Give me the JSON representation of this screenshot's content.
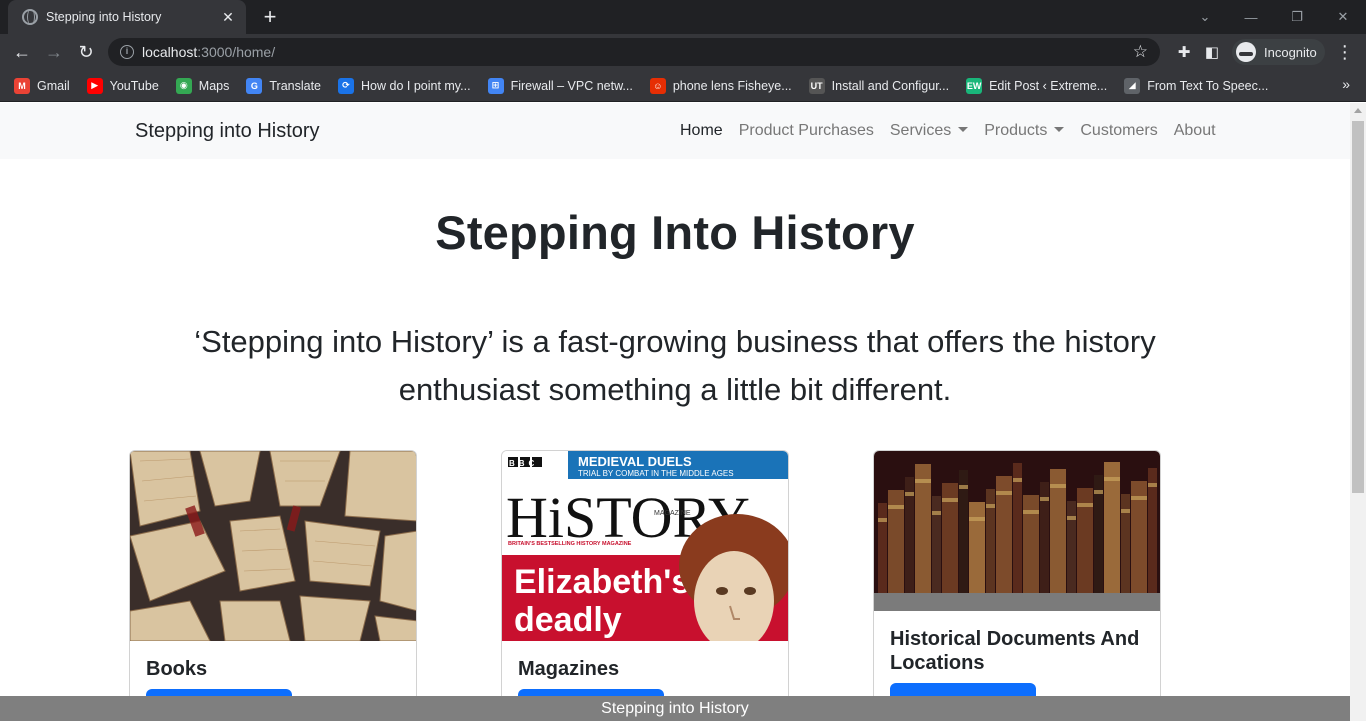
{
  "browser": {
    "tab_title": "Stepping into History",
    "tab_close": "✕",
    "new_tab": "+",
    "url_host": "localhost",
    "url_path": ":3000/home/",
    "profile_label": "Incognito",
    "bookmarks": [
      {
        "label": "Gmail",
        "icon": "gmail-icon",
        "color": "#ea4335",
        "glyph": "M"
      },
      {
        "label": "YouTube",
        "icon": "youtube-icon",
        "color": "#ff0000",
        "glyph": "▶"
      },
      {
        "label": "Maps",
        "icon": "maps-icon",
        "color": "#34a853",
        "glyph": "◉"
      },
      {
        "label": "Translate",
        "icon": "translate-icon",
        "color": "#4285f4",
        "glyph": "G"
      },
      {
        "label": "How do I point my...",
        "icon": "link-icon",
        "color": "#1a73e8",
        "glyph": "⟳"
      },
      {
        "label": "Firewall – VPC netw...",
        "icon": "gcp-icon",
        "color": "#4285f4",
        "glyph": "⊞"
      },
      {
        "label": "phone lens Fisheye...",
        "icon": "aliexpress-icon",
        "color": "#e62e04",
        "glyph": "☺"
      },
      {
        "label": "Install and Configur...",
        "icon": "ut-icon",
        "color": "#555555",
        "glyph": "UT"
      },
      {
        "label": "Edit Post ‹ Extreme...",
        "icon": "wordpress-icon",
        "color": "#19b67a",
        "glyph": "EW"
      },
      {
        "label": "From Text To Speec...",
        "icon": "speech-icon",
        "color": "#5f6368",
        "glyph": "◢"
      }
    ]
  },
  "site": {
    "brand": "Stepping into History",
    "nav": [
      {
        "label": "Home",
        "active": true,
        "dropdown": false
      },
      {
        "label": "Product Purchases",
        "active": false,
        "dropdown": false
      },
      {
        "label": "Services",
        "active": false,
        "dropdown": true
      },
      {
        "label": "Products",
        "active": false,
        "dropdown": true
      },
      {
        "label": "Customers",
        "active": false,
        "dropdown": false
      },
      {
        "label": "About",
        "active": false,
        "dropdown": false
      }
    ],
    "hero_title": "Stepping Into History",
    "hero_text": "‘Stepping into History’ is a fast-growing business that offers the history enthusiast something a little bit different.",
    "cards": [
      {
        "title": "Books",
        "image": "books-image"
      },
      {
        "title": "Magazines",
        "image": "magazine-image",
        "magazine": {
          "bbc": "BBC",
          "banner1": "MEDIEVAL DUELS",
          "banner2": "TRIAL BY COMBAT IN THE MIDDLE AGES",
          "masthead": "HiSTORY",
          "mag_small": "MAGAZINE",
          "tagline": "BRITAIN'S BESTSELLING HISTORY MAGAZINE",
          "headline1": "Elizabeth's",
          "headline2": "deadly"
        }
      },
      {
        "title": "Historical Documents And Locations",
        "image": "old-books-shelf-image"
      }
    ],
    "footer": "Stepping into History"
  },
  "colors": {
    "primary": "#0d6efd",
    "footer": "#7f7f7f",
    "navbar": "#f8f9fa"
  }
}
